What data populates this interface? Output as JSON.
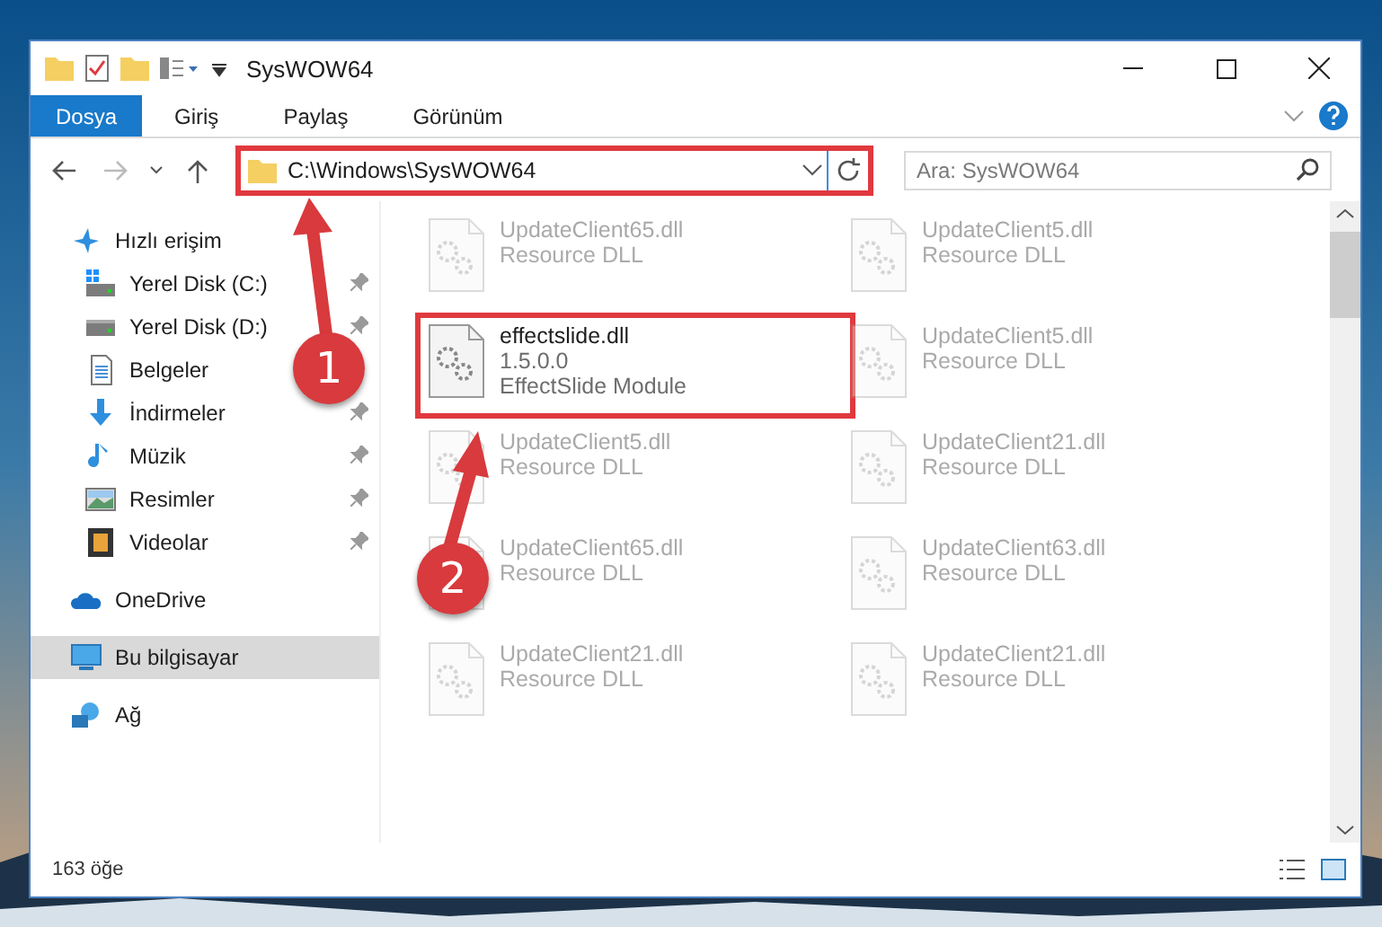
{
  "window": {
    "title": "SysWOW64"
  },
  "ribbon_tabs": [
    {
      "label": "Dosya",
      "kind": "file"
    },
    {
      "label": "Giriş",
      "kind": "tab"
    },
    {
      "label": "Paylaş",
      "kind": "tab"
    },
    {
      "label": "Görünüm",
      "kind": "tab"
    }
  ],
  "address": {
    "path": "C:\\Windows\\SysWOW64",
    "highlighted": true
  },
  "search": {
    "placeholder": "Ara: SysWOW64"
  },
  "sidebar": {
    "items": [
      {
        "label": "Hızlı erişim",
        "kind": "star",
        "selected": false,
        "children": [
          {
            "label": "Yerel Disk (C:)",
            "kind": "sysdrive",
            "selected": false,
            "pinned": true
          },
          {
            "label": "Yerel Disk (D:)",
            "kind": "drive",
            "selected": false,
            "pinned": true
          },
          {
            "label": "Belgeler",
            "kind": "documents",
            "selected": false,
            "pinned": false
          },
          {
            "label": "İndirmeler",
            "kind": "download",
            "selected": false,
            "pinned": true
          },
          {
            "label": "Müzik",
            "kind": "music",
            "selected": false,
            "pinned": true
          },
          {
            "label": "Resimler",
            "kind": "pictures",
            "selected": false,
            "pinned": true
          },
          {
            "label": "Videolar",
            "kind": "videos",
            "selected": false,
            "pinned": true
          }
        ]
      },
      {
        "label": "OneDrive",
        "kind": "cloud",
        "selected": false
      },
      {
        "label": "Bu bilgisayar",
        "kind": "computer",
        "selected": true
      },
      {
        "label": "Ağ",
        "kind": "network",
        "selected": false
      }
    ]
  },
  "files": [
    {
      "name": "UpdateClient65.dll",
      "lines": [
        "Resource DLL"
      ],
      "blurred": true,
      "highlighted": false
    },
    {
      "name": "UpdateClient5.dll",
      "lines": [
        "Resource DLL"
      ],
      "blurred": true,
      "highlighted": false
    },
    {
      "name": "effectslide.dll",
      "lines": [
        "1.5.0.0",
        "EffectSlide Module"
      ],
      "blurred": false,
      "highlighted": true
    },
    {
      "name": "UpdateClient5.dll",
      "lines": [
        "Resource DLL"
      ],
      "blurred": true,
      "highlighted": false
    },
    {
      "name": "UpdateClient5.dll",
      "lines": [
        "Resource DLL"
      ],
      "blurred": true,
      "highlighted": false
    },
    {
      "name": "UpdateClient21.dll",
      "lines": [
        "Resource DLL"
      ],
      "blurred": true,
      "highlighted": false
    },
    {
      "name": "UpdateClient65.dll",
      "lines": [
        "Resource DLL"
      ],
      "blurred": true,
      "highlighted": false
    },
    {
      "name": "UpdateClient63.dll",
      "lines": [
        "Resource DLL"
      ],
      "blurred": true,
      "highlighted": false
    },
    {
      "name": "UpdateClient21.dll",
      "lines": [
        "Resource DLL"
      ],
      "blurred": true,
      "highlighted": false
    },
    {
      "name": "UpdateClient21.dll",
      "lines": [
        "Resource DLL"
      ],
      "blurred": true,
      "highlighted": false
    }
  ],
  "status_bar": {
    "item_count": "163 öğe"
  },
  "callouts": [
    {
      "number": "1"
    },
    {
      "number": "2"
    }
  ]
}
